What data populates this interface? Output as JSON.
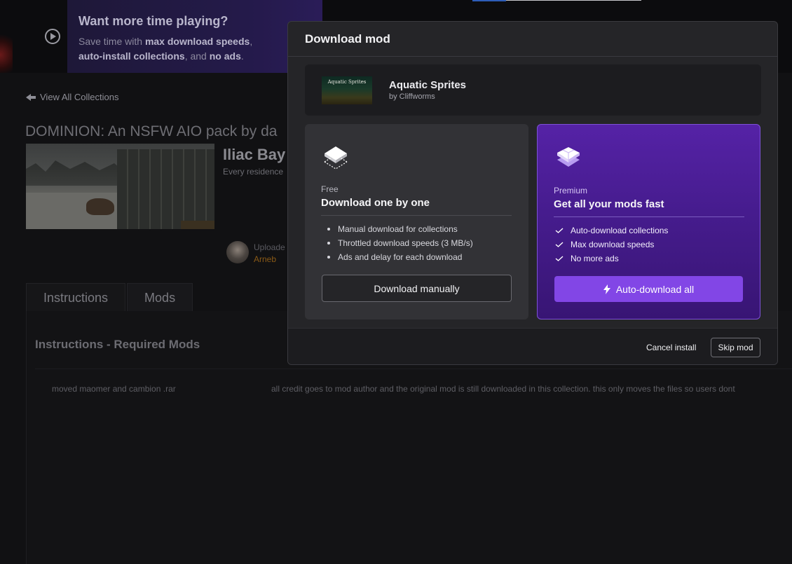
{
  "promo": {
    "title": "Want more time playing?",
    "line1_pre": "Save time with ",
    "line1_bold": "max download speeds",
    "line1_post": ",",
    "line2_bold": "auto-install collections",
    "line2_mid": ", and ",
    "line2_bold2": "no ads",
    "line2_post": "."
  },
  "collection": {
    "view_all": "View All Collections",
    "title": "DOMINION: An NSFW AIO pack by da",
    "mod_name": "Iliac Bay",
    "mod_sub": "Every residence",
    "uploader_label": "Uploade",
    "uploader_name": "Arneb",
    "tabs": [
      "Instructions",
      "Mods"
    ],
    "section_title": "Instructions - Required Mods",
    "row": {
      "left": "moved maomer and cambion .rar",
      "right": "all credit goes to mod author and the original mod is still downloaded in this collection. this only moves the files so users dont"
    }
  },
  "modal": {
    "title": "Download mod",
    "mod": {
      "thumb_caption": "Aquatic Sprites",
      "name": "Aquatic Sprites",
      "author": "by Cliffworms"
    },
    "free": {
      "icon": "layers-icon",
      "kicker": "Free",
      "heading": "Download one by one",
      "features": [
        "Manual download for collections",
        "Throttled download speeds (3 MB/s)",
        "Ads and delay for each download"
      ],
      "button": "Download manually"
    },
    "premium": {
      "icon": "diamond-icon",
      "kicker": "Premium",
      "heading": "Get all your mods fast",
      "features": [
        "Auto-download collections",
        "Max download speeds",
        "No more ads"
      ],
      "button": "Auto-download all",
      "button_icon": "lightning-icon"
    },
    "footer": {
      "cancel": "Cancel install",
      "skip": "Skip mod"
    }
  },
  "colors": {
    "premium_bg": "#4a1c94",
    "premium_button": "#8246e6",
    "modal_bg": "#252528"
  }
}
